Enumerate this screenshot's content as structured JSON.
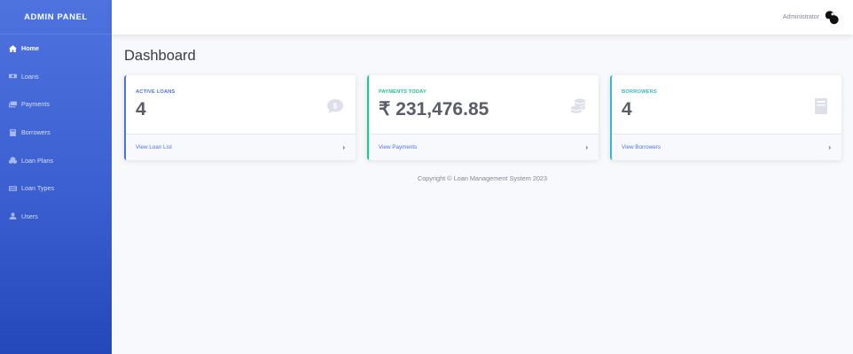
{
  "sidebar": {
    "brand": "ADMIN PANEL",
    "items": [
      {
        "label": "Home",
        "icon": "home-icon",
        "active": true
      },
      {
        "label": "Loans",
        "icon": "money-icon",
        "active": false
      },
      {
        "label": "Payments",
        "icon": "money-bills-icon",
        "active": false
      },
      {
        "label": "Borrowers",
        "icon": "book-icon",
        "active": false
      },
      {
        "label": "Loan Plans",
        "icon": "cubes-icon",
        "active": false
      },
      {
        "label": "Loan Types",
        "icon": "list-icon",
        "active": false
      },
      {
        "label": "Users",
        "icon": "user-icon",
        "active": false
      }
    ]
  },
  "topbar": {
    "user_name": "Administrator",
    "avatar_icon": "user-avatar-icon"
  },
  "main": {
    "title": "Dashboard",
    "cards": [
      {
        "label": "ACTIVE LOANS",
        "value": "4",
        "link": "View Loan List",
        "arrow": "›",
        "icon": "dollar-comment-icon",
        "accent": "#4e73df"
      },
      {
        "label": "PAYMENTS TODAY",
        "value": "₹ 231,476.85",
        "link": "View Payments",
        "arrow": "›",
        "icon": "coins-icon",
        "accent": "#1cc88a"
      },
      {
        "label": "BORROWERS",
        "value": "4",
        "link": "View Borrowers",
        "arrow": "›",
        "icon": "book-icon",
        "accent": "#36b9cc"
      }
    ],
    "copyright": "Copyright © Loan Management System 2023"
  }
}
